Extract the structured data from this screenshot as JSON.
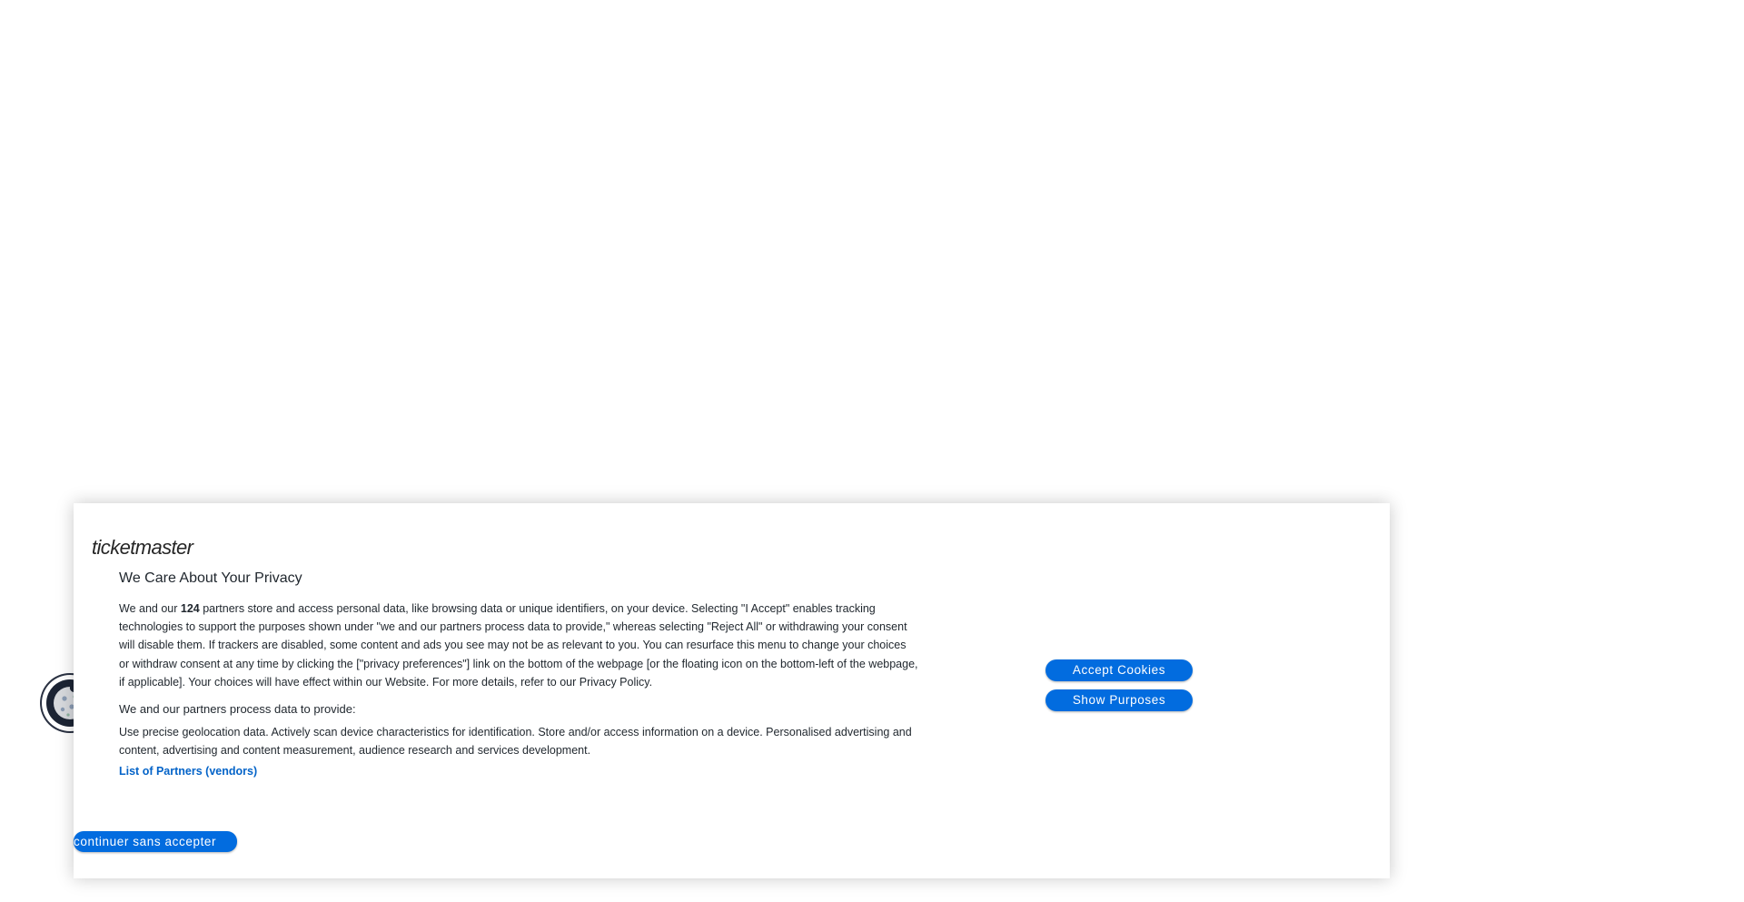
{
  "brand": {
    "logo_text": "ticketmaster"
  },
  "consent": {
    "title": "We Care About Your Privacy",
    "policy_before_count": "We and our ",
    "partner_count": "124",
    "policy_after_count": " partners store and access personal data, like browsing data or unique identifiers, on your device. Selecting \"I Accept\" enables tracking technologies to support the purposes shown under \"we and our partners process data to provide,\" whereas selecting \"Reject All\" or withdrawing your consent will disable them. If trackers are disabled, some content and ads you see may not be as relevant to you. You can resurface this menu to change your choices or withdraw consent at any time by clicking the [\"privacy preferences\"] link on the bottom of the webpage [or the floating icon on the bottom-left of the webpage, if applicable]. Your choices will have effect within our Website. For more details, refer to our Privacy Policy.",
    "purposes_heading": "We and our partners process data to provide:",
    "purposes_text": "Use precise geolocation data. Actively scan device characteristics for identification. Store and/or access information on a device. Personalised advertising and content, advertising and content measurement, audience research and services development.",
    "vendors_link": "List of Partners (vendors)",
    "accept_label": "Accept Cookies",
    "show_purposes_label": "Show Purposes",
    "continue_label": "continuer sans accepter"
  },
  "colors": {
    "button_blue": "#026cdf",
    "link_blue": "#0363c8",
    "text": "#1f262d"
  },
  "icons": {
    "cookie_widget": "cookie-icon"
  }
}
